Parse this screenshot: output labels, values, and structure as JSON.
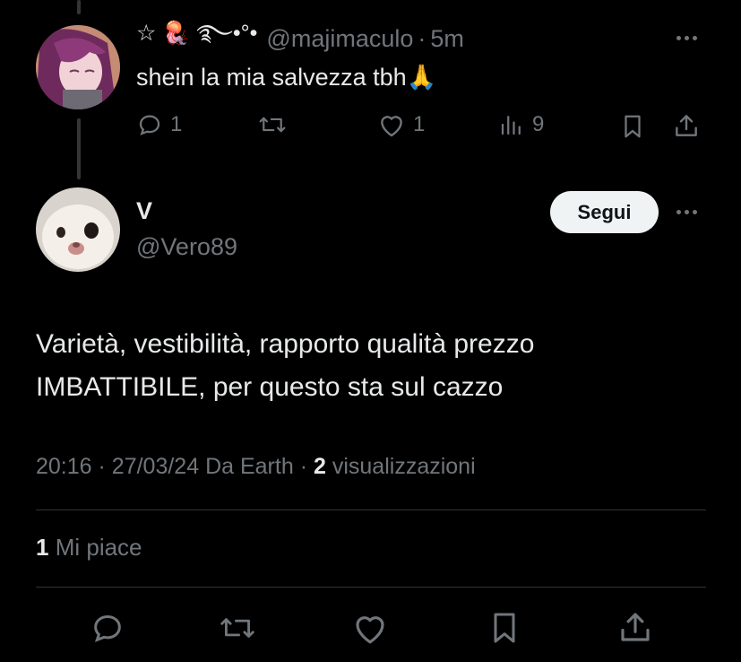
{
  "reply": {
    "name_glyphs": "☆ 🪼 ࿐•°•",
    "handle": "@majimaculo",
    "separator": "·",
    "time": "5m",
    "text": "shein la mia salvezza tbh",
    "emoji": "🙏",
    "actions": {
      "replies": "1",
      "reposts": "",
      "likes": "1",
      "views": "9"
    }
  },
  "main": {
    "name": "V",
    "handle": "@Vero89",
    "follow_label": "Segui",
    "text_line1": "Varietà, vestibilità, rapporto qualità prezzo",
    "text_line2": "IMBATTIBILE, per questo sta sul cazzo",
    "meta": {
      "time": "20:16",
      "sep1": "·",
      "date": "27/03/24",
      "source": "Da Earth",
      "sep2": "·",
      "views_count": "2",
      "views_label": "visualizzazioni"
    },
    "likes": {
      "count": "1",
      "label": "Mi piace"
    }
  },
  "colors": {
    "background": "#000000",
    "text": "#e7e9ea",
    "muted": "#71767b",
    "divider": "#2f3336",
    "button": "#eff3f4"
  }
}
